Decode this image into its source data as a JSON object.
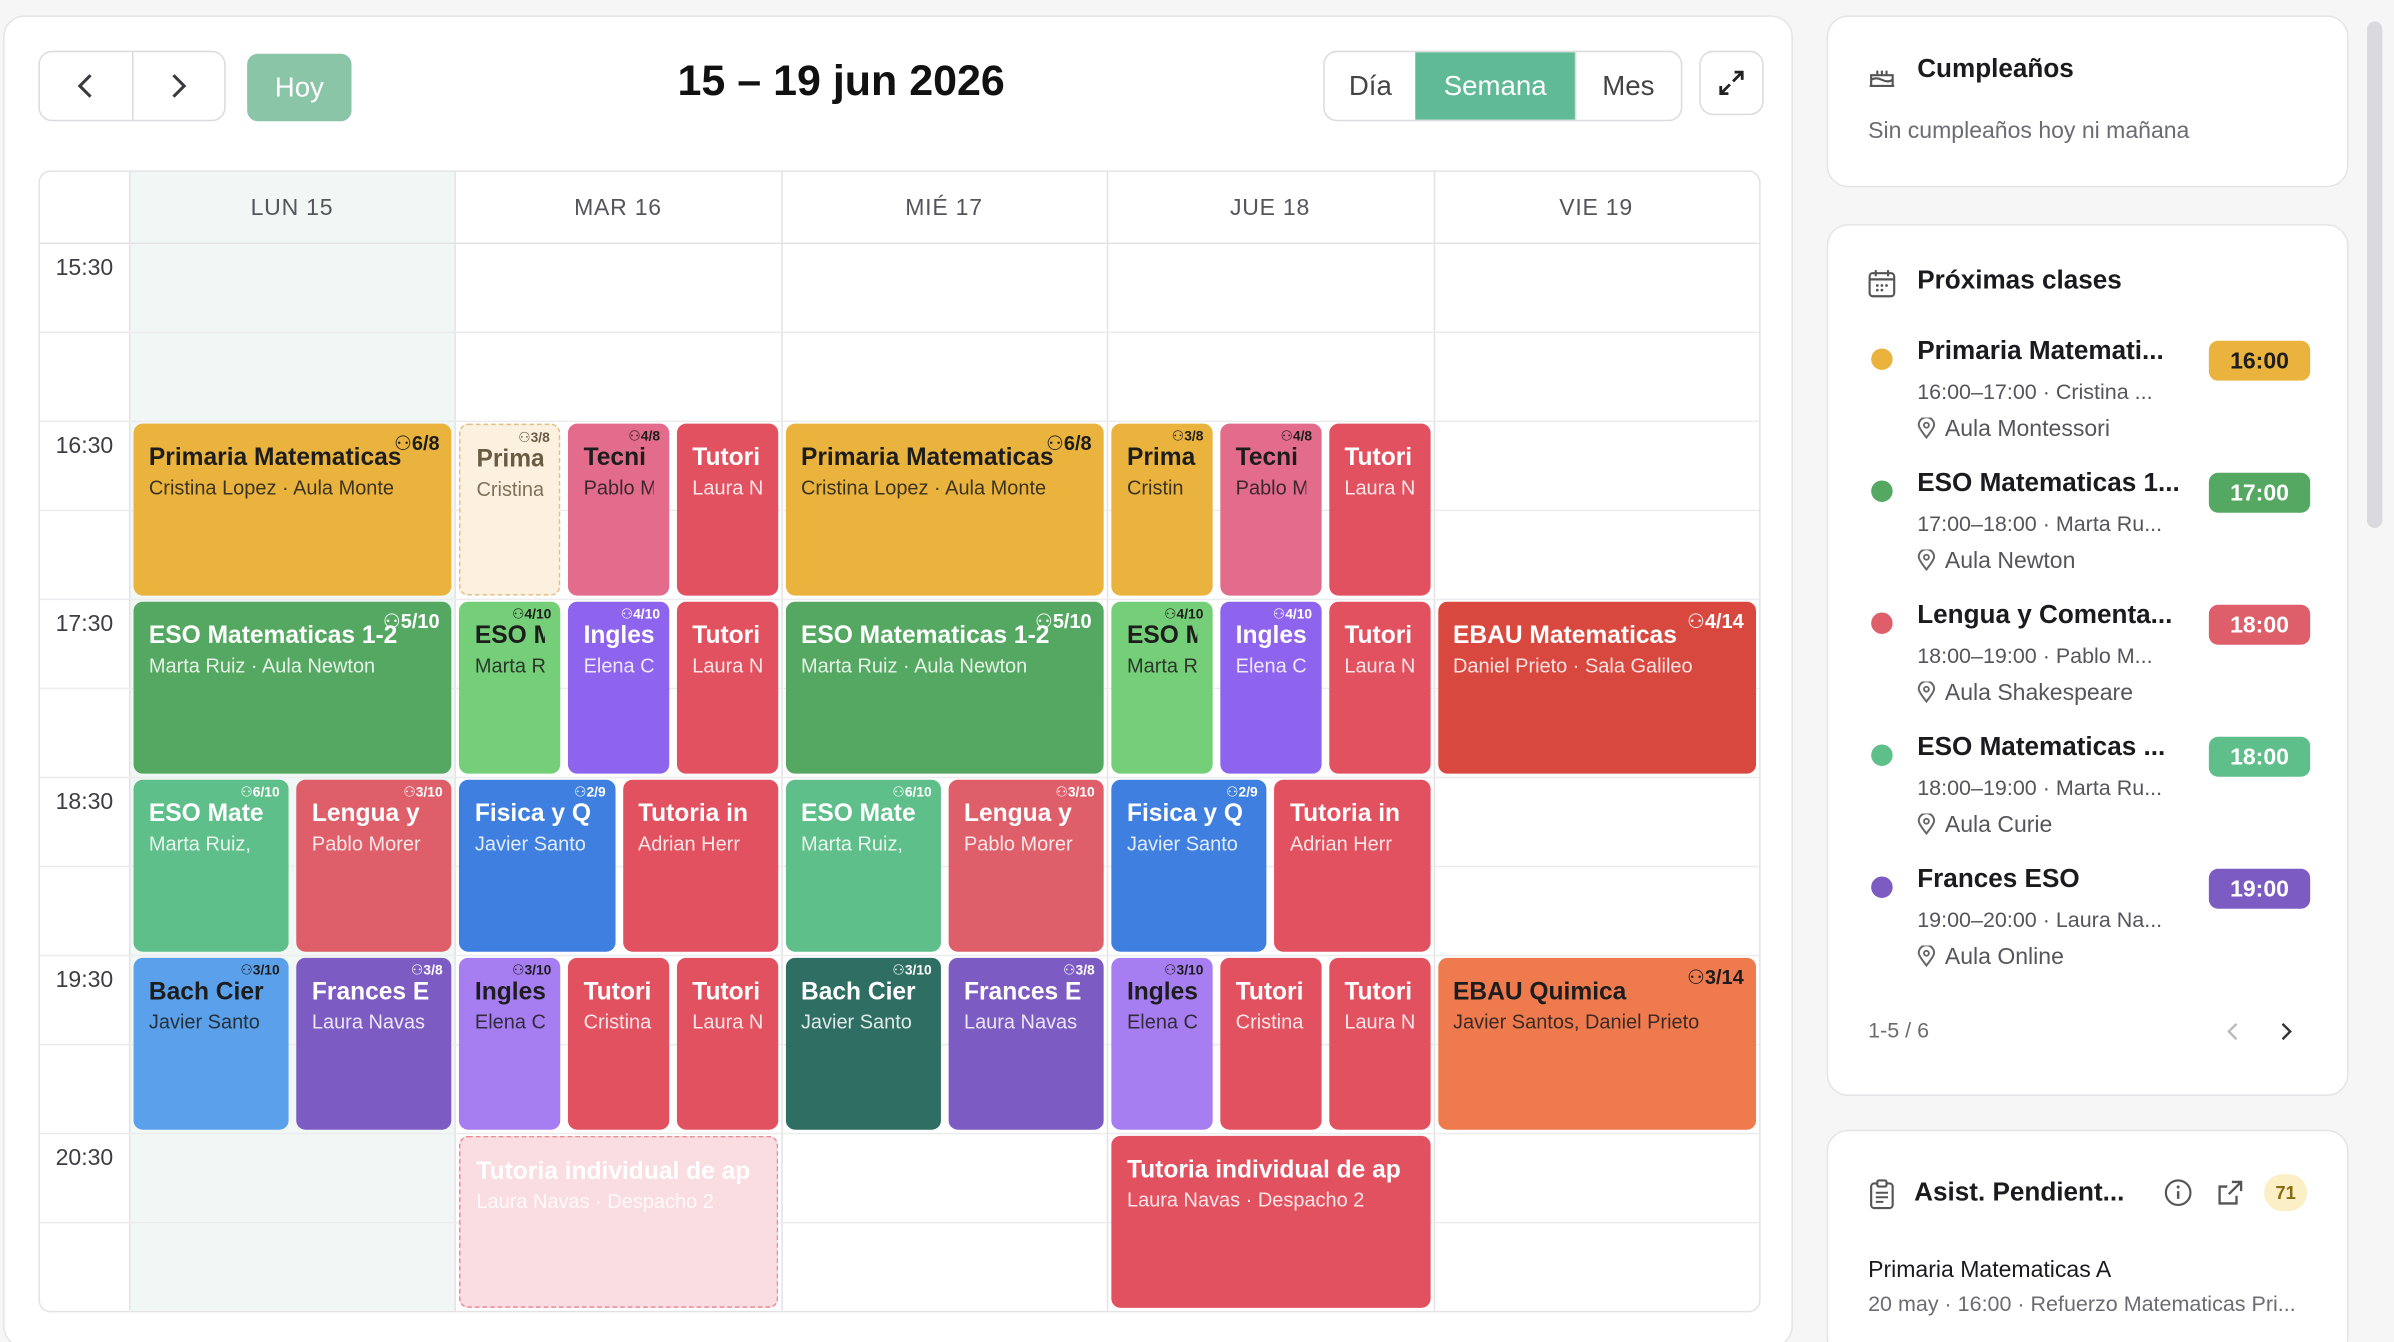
{
  "calendar": {
    "nav_prev": "‹",
    "nav_next": "›",
    "today_label": "Hoy",
    "range_title": "15 – 19 jun 2026",
    "views": [
      {
        "label": "Día",
        "active": false
      },
      {
        "label": "Semana",
        "active": true
      },
      {
        "label": "Mes",
        "active": false
      }
    ],
    "days": [
      "LUN 15",
      "MAR 16",
      "MIÉ 17",
      "JUE 18",
      "VIE 19"
    ],
    "times": [
      "15:30",
      "16:30",
      "17:30",
      "18:30",
      "19:30",
      "20:30"
    ]
  },
  "events": [
    {
      "day": 0,
      "col": 0,
      "cols": 1,
      "start": "16:00",
      "end": "17:00",
      "title": "Primaria Matematicas",
      "sub": "Cristina Lopez · Aula Monte",
      "cap": "6/8",
      "color": "#e9b33d",
      "text": "dark"
    },
    {
      "day": 0,
      "col": 0,
      "cols": 1,
      "start": "17:00",
      "end": "18:00",
      "title": "ESO Matematicas 1-2",
      "sub": "Marta Ruiz · Aula Newton",
      "cap": "5/10",
      "color": "#55a862"
    },
    {
      "day": 0,
      "col": 0,
      "cols": 2,
      "start": "18:00",
      "end": "19:00",
      "title": "ESO Mate",
      "sub": "Marta Ruiz,",
      "cap": "6/10",
      "color": "#5fbf8a",
      "sm": true
    },
    {
      "day": 0,
      "col": 1,
      "cols": 2,
      "start": "18:00",
      "end": "19:00",
      "title": "Lengua y",
      "sub": "Pablo Morer",
      "cap": "3/10",
      "color": "#de5f6a",
      "sm": true
    },
    {
      "day": 0,
      "col": 0,
      "cols": 2,
      "start": "19:00",
      "end": "20:00",
      "title": "Bach Cier",
      "sub": "Javier Santo",
      "cap": "3/10",
      "color": "#5aa0ea",
      "text": "dark",
      "sm": true
    },
    {
      "day": 0,
      "col": 1,
      "cols": 2,
      "start": "19:00",
      "end": "20:00",
      "title": "Frances E",
      "sub": "Laura Navas",
      "cap": "3/8",
      "color": "#7c5cc3",
      "sm": true
    },
    {
      "day": 1,
      "col": 0,
      "cols": 3,
      "start": "16:00",
      "end": "17:00",
      "title": "Prima",
      "sub": "Cristina",
      "cap": "3/8",
      "color": "ghost",
      "sm": true
    },
    {
      "day": 1,
      "col": 1,
      "cols": 3,
      "start": "16:00",
      "end": "17:00",
      "title": "Tecni",
      "sub": "Pablo M",
      "cap": "4/8",
      "color": "#e36b8c",
      "text": "dark",
      "sm": true
    },
    {
      "day": 1,
      "col": 2,
      "cols": 3,
      "start": "16:00",
      "end": "17:00",
      "title": "Tutori",
      "sub": "Laura N",
      "cap": "",
      "color": "#e2515f",
      "sm": true
    },
    {
      "day": 1,
      "col": 0,
      "cols": 3,
      "start": "17:00",
      "end": "18:00",
      "title": "ESO M",
      "sub": "Marta R",
      "cap": "4/10",
      "color": "#75cf78",
      "text": "dark",
      "sm": true
    },
    {
      "day": 1,
      "col": 1,
      "cols": 3,
      "start": "17:00",
      "end": "18:00",
      "title": "Ingles",
      "sub": "Elena C",
      "cap": "4/10",
      "color": "#8e63ee",
      "sm": true
    },
    {
      "day": 1,
      "col": 2,
      "cols": 3,
      "start": "17:00",
      "end": "18:00",
      "title": "Tutori",
      "sub": "Laura N",
      "cap": "",
      "color": "#e2515f",
      "sm": true
    },
    {
      "day": 1,
      "col": 0,
      "cols": 2,
      "start": "18:00",
      "end": "19:00",
      "title": "Fisica y Q",
      "sub": "Javier Santo",
      "cap": "2/9",
      "color": "#3e7fe0",
      "sm": true
    },
    {
      "day": 1,
      "col": 1,
      "cols": 2,
      "start": "18:00",
      "end": "19:00",
      "title": "Tutoria in",
      "sub": "Adrian Herr",
      "cap": "",
      "color": "#e2515f",
      "sm": true
    },
    {
      "day": 1,
      "col": 0,
      "cols": 3,
      "start": "19:00",
      "end": "20:00",
      "title": "Ingles",
      "sub": "Elena C",
      "cap": "3/10",
      "color": "#a67ef2",
      "text": "dark",
      "sm": true
    },
    {
      "day": 1,
      "col": 1,
      "cols": 3,
      "start": "19:00",
      "end": "20:00",
      "title": "Tutori",
      "sub": "Cristina",
      "cap": "",
      "color": "#e2515f",
      "sm": true
    },
    {
      "day": 1,
      "col": 2,
      "cols": 3,
      "start": "19:00",
      "end": "20:00",
      "title": "Tutori",
      "sub": "Laura N",
      "cap": "",
      "color": "#e2515f",
      "sm": true
    },
    {
      "day": 1,
      "col": 0,
      "cols": 1,
      "start": "20:00",
      "end": "21:00",
      "title": "Tutoria individual de ap",
      "sub": "Laura Navas · Despacho 2",
      "cap": "",
      "color": "ghost-red"
    },
    {
      "day": 2,
      "col": 0,
      "cols": 1,
      "start": "16:00",
      "end": "17:00",
      "title": "Primaria Matematicas",
      "sub": "Cristina Lopez · Aula Monte",
      "cap": "6/8",
      "color": "#e9b33d",
      "text": "dark"
    },
    {
      "day": 2,
      "col": 0,
      "cols": 1,
      "start": "17:00",
      "end": "18:00",
      "title": "ESO Matematicas 1-2",
      "sub": "Marta Ruiz · Aula Newton",
      "cap": "5/10",
      "color": "#55a862"
    },
    {
      "day": 2,
      "col": 0,
      "cols": 2,
      "start": "18:00",
      "end": "19:00",
      "title": "ESO Mate",
      "sub": "Marta Ruiz,",
      "cap": "6/10",
      "color": "#5fbf8a",
      "sm": true
    },
    {
      "day": 2,
      "col": 1,
      "cols": 2,
      "start": "18:00",
      "end": "19:00",
      "title": "Lengua y",
      "sub": "Pablo Morer",
      "cap": "3/10",
      "color": "#de5f6a",
      "sm": true
    },
    {
      "day": 2,
      "col": 0,
      "cols": 2,
      "start": "19:00",
      "end": "20:00",
      "title": "Bach Cier",
      "sub": "Javier Santo",
      "cap": "3/10",
      "color": "#2f6f63",
      "sm": true
    },
    {
      "day": 2,
      "col": 1,
      "cols": 2,
      "start": "19:00",
      "end": "20:00",
      "title": "Frances E",
      "sub": "Laura Navas",
      "cap": "3/8",
      "color": "#7c5cc3",
      "sm": true
    },
    {
      "day": 3,
      "col": 0,
      "cols": 3,
      "start": "16:00",
      "end": "17:00",
      "title": "Prima",
      "sub": "Cristin",
      "cap": "3/8",
      "color": "#e9b33d",
      "text": "dark",
      "sm": true
    },
    {
      "day": 3,
      "col": 1,
      "cols": 3,
      "start": "16:00",
      "end": "17:00",
      "title": "Tecni",
      "sub": "Pablo M",
      "cap": "4/8",
      "color": "#e36b8c",
      "text": "dark",
      "sm": true
    },
    {
      "day": 3,
      "col": 2,
      "cols": 3,
      "start": "16:00",
      "end": "17:00",
      "title": "Tutori",
      "sub": "Laura N",
      "cap": "",
      "color": "#e2515f",
      "sm": true
    },
    {
      "day": 3,
      "col": 0,
      "cols": 3,
      "start": "17:00",
      "end": "18:00",
      "title": "ESO M",
      "sub": "Marta R",
      "cap": "4/10",
      "color": "#75cf78",
      "text": "dark",
      "sm": true
    },
    {
      "day": 3,
      "col": 1,
      "cols": 3,
      "start": "17:00",
      "end": "18:00",
      "title": "Ingles",
      "sub": "Elena C",
      "cap": "4/10",
      "color": "#8e63ee",
      "sm": true
    },
    {
      "day": 3,
      "col": 2,
      "cols": 3,
      "start": "17:00",
      "end": "18:00",
      "title": "Tutori",
      "sub": "Laura N",
      "cap": "",
      "color": "#e2515f",
      "sm": true
    },
    {
      "day": 3,
      "col": 0,
      "cols": 2,
      "start": "18:00",
      "end": "19:00",
      "title": "Fisica y Q",
      "sub": "Javier Santo",
      "cap": "2/9",
      "color": "#3e7fe0",
      "sm": true
    },
    {
      "day": 3,
      "col": 1,
      "cols": 2,
      "start": "18:00",
      "end": "19:00",
      "title": "Tutoria in",
      "sub": "Adrian Herr",
      "cap": "",
      "color": "#e2515f",
      "sm": true
    },
    {
      "day": 3,
      "col": 0,
      "cols": 3,
      "start": "19:00",
      "end": "20:00",
      "title": "Ingles",
      "sub": "Elena C",
      "cap": "3/10",
      "color": "#a67ef2",
      "text": "dark",
      "sm": true
    },
    {
      "day": 3,
      "col": 1,
      "cols": 3,
      "start": "19:00",
      "end": "20:00",
      "title": "Tutori",
      "sub": "Cristina",
      "cap": "",
      "color": "#e2515f",
      "sm": true
    },
    {
      "day": 3,
      "col": 2,
      "cols": 3,
      "start": "19:00",
      "end": "20:00",
      "title": "Tutori",
      "sub": "Laura N",
      "cap": "",
      "color": "#e2515f",
      "sm": true
    },
    {
      "day": 3,
      "col": 0,
      "cols": 1,
      "start": "20:00",
      "end": "21:00",
      "title": "Tutoria individual de ap",
      "sub": "Laura Navas · Despacho 2",
      "cap": "",
      "color": "#e2515f"
    },
    {
      "day": 4,
      "col": 0,
      "cols": 1,
      "start": "17:00",
      "end": "18:00",
      "title": "EBAU Matematicas",
      "sub": "Daniel Prieto · Sala Galileo",
      "cap": "4/14",
      "color": "#d9483f"
    },
    {
      "day": 4,
      "col": 0,
      "cols": 1,
      "start": "19:00",
      "end": "20:00",
      "title": "EBAU Quimica",
      "sub": "Javier Santos, Daniel Prieto",
      "cap": "3/14",
      "color": "#ee7a4e",
      "text": "dark"
    }
  ],
  "birthdays": {
    "title": "Cumpleaños",
    "empty_text": "Sin cumpleaños hoy ni mañana"
  },
  "upcoming": {
    "title": "Próximas clases",
    "items": [
      {
        "name": "Primaria Matemati...",
        "sub": "16:00–17:00 · Cristina ...",
        "loc": "Aula Montessori",
        "time": "16:00",
        "color": "#e9b33d",
        "text": "#1d1d1d"
      },
      {
        "name": "ESO Matematicas 1...",
        "sub": "17:00–18:00 · Marta Ru...",
        "loc": "Aula Newton",
        "time": "17:00",
        "color": "#55a862",
        "text": "#ffffff"
      },
      {
        "name": "Lengua y Comenta...",
        "sub": "18:00–19:00 · Pablo M...",
        "loc": "Aula Shakespeare",
        "time": "18:00",
        "color": "#de5f6a",
        "text": "#ffffff"
      },
      {
        "name": "ESO Matematicas ...",
        "sub": "18:00–19:00 · Marta Ru...",
        "loc": "Aula Curie",
        "time": "18:00",
        "color": "#5fbf8a",
        "text": "#ffffff"
      },
      {
        "name": "Frances ESO",
        "sub": "19:00–20:00 · Laura Na...",
        "loc": "Aula Online",
        "time": "19:00",
        "color": "#7c5cc3",
        "text": "#ffffff"
      }
    ],
    "pagination": "1-5 / 6"
  },
  "pending": {
    "title": "Asist. Pendient...",
    "count": "71",
    "item_title": "Primaria Matematicas A",
    "item_sub": "20 may · 16:00 · Refuerzo Matematicas Pri..."
  }
}
